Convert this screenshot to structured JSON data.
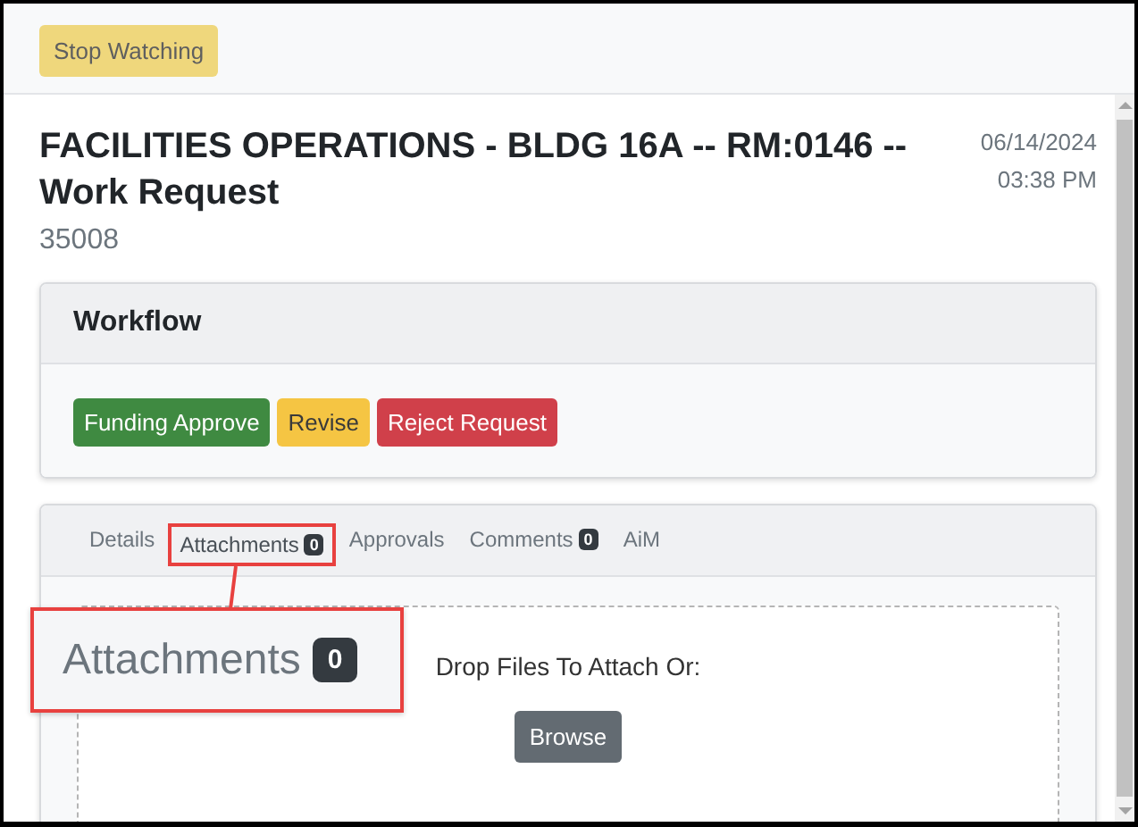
{
  "toolbar": {
    "buttons": [
      {
        "label": "Stop Watching",
        "kind": "warning"
      }
    ]
  },
  "header": {
    "title": "FACILITIES OPERATIONS - BLDG 16A -- RM:0146 -- Work Request",
    "number": "35008",
    "date": "06/14/2024",
    "time": "03:38 PM"
  },
  "workflow": {
    "title": "Workflow",
    "buttons": [
      {
        "label": "Funding Approve",
        "kind": "success"
      },
      {
        "label": "Revise",
        "kind": "warning"
      },
      {
        "label": "Reject Request",
        "kind": "danger"
      }
    ]
  },
  "tabs": [
    {
      "label": "Details",
      "selected": false,
      "annotated": false
    },
    {
      "label": "Attachments",
      "badge": "0",
      "selected": true,
      "annotated": true
    },
    {
      "label": "Approvals",
      "selected": false,
      "annotated": false
    },
    {
      "label": "Comments",
      "badge": "0",
      "selected": false,
      "annotated": false
    },
    {
      "label": "AiM",
      "selected": false,
      "annotated": false
    }
  ],
  "dropzone": {
    "prompt": "Drop Files To Attach Or:",
    "button": "Browse"
  },
  "callout": {
    "label": "Attachments",
    "badge": "0"
  }
}
